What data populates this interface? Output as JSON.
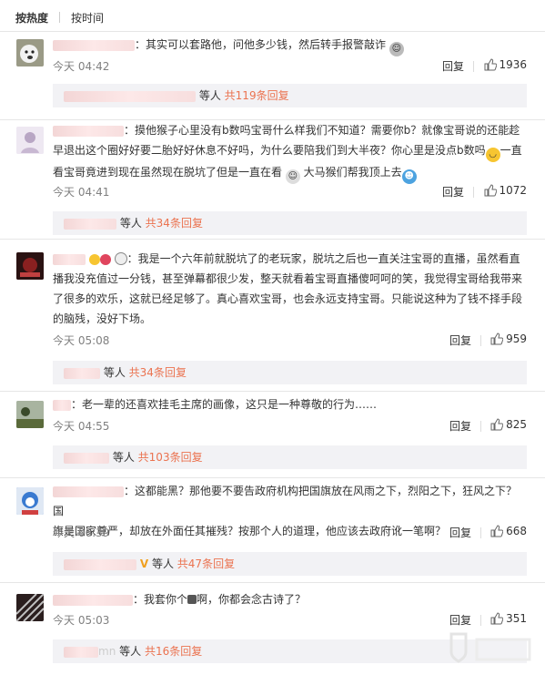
{
  "tabs": {
    "hot": "按热度",
    "time": "按时间"
  },
  "comments": [
    {
      "text": "：其实可以套路他，问他多少钱，然后转手报警敲诈",
      "time": "今天 04:42",
      "reply": "回复",
      "likes": "1936",
      "sub": {
        "suffix": "等人",
        "count": "共119条回复"
      }
    },
    {
      "text1": "：摸他猴子心里没有b数吗宝哥什么样我们不知道？需要你b？就像宝哥说的还能趁",
      "text2": "早退出这个圈好好要二胎好好休息不好吗，为什么要陪我们到大半夜？你心里是没点b数吗",
      "text2b": "一直",
      "text3": "看宝哥竟进到现在虽然现在脱坑了但是一直在看",
      "text3b": "大马猴们帮我顶上去",
      "time": "今天 04:41",
      "reply": "回复",
      "likes": "1072",
      "sub": {
        "suffix": "等人",
        "count": "共34条回复"
      }
    },
    {
      "text1": "：我是一个六年前就脱坑了的老玩家，脱坑之后也一直关注宝哥的直播，虽然看直",
      "text2": "播我没充值过一分钱，甚至弹幕都很少发，整天就看着宝哥直播傻呵呵的笑，我觉得宝哥给我带来",
      "text3": "了很多的欢乐，这就已经足够了。真心喜欢宝哥，也会永远支持宝哥。只能说这种为了钱不择手段",
      "text4": "的脑残，没好下场。",
      "time": "今天 05:08",
      "reply": "回复",
      "likes": "959",
      "sub": {
        "suffix": "等人",
        "count": "共34条回复"
      }
    },
    {
      "text": "：老一辈的还喜欢挂毛主席的画像，这只是一种尊敬的行为……",
      "time": "今天 04:55",
      "reply": "回复",
      "likes": "825",
      "sub": {
        "suffix": "等人",
        "count": "共103条回复"
      }
    },
    {
      "text1": "：这都能黑？那他要不要告政府机构把国旗放在风雨之下，烈阳之下，狂风之下？国",
      "text2": "旗是国家尊严，却放在外面任其摧残？按那个人的道理，他应该去政府讹一笔啊？",
      "time": "今天 06:39",
      "reply": "回复",
      "likes": "668",
      "sub": {
        "suffix": "等人",
        "count": "共47条回复"
      }
    },
    {
      "text": "：我套你个",
      "text_b": "啊，你都会念古诗了？",
      "time": "今天 05:03",
      "reply": "回复",
      "likes": "351",
      "sub": {
        "prefix": "mn",
        "suffix": "等人",
        "count": "共16条回复"
      }
    }
  ],
  "colors": {
    "accent": "#eb7350",
    "link": "#eb7350",
    "text": "#333333",
    "meta": "#808080"
  }
}
